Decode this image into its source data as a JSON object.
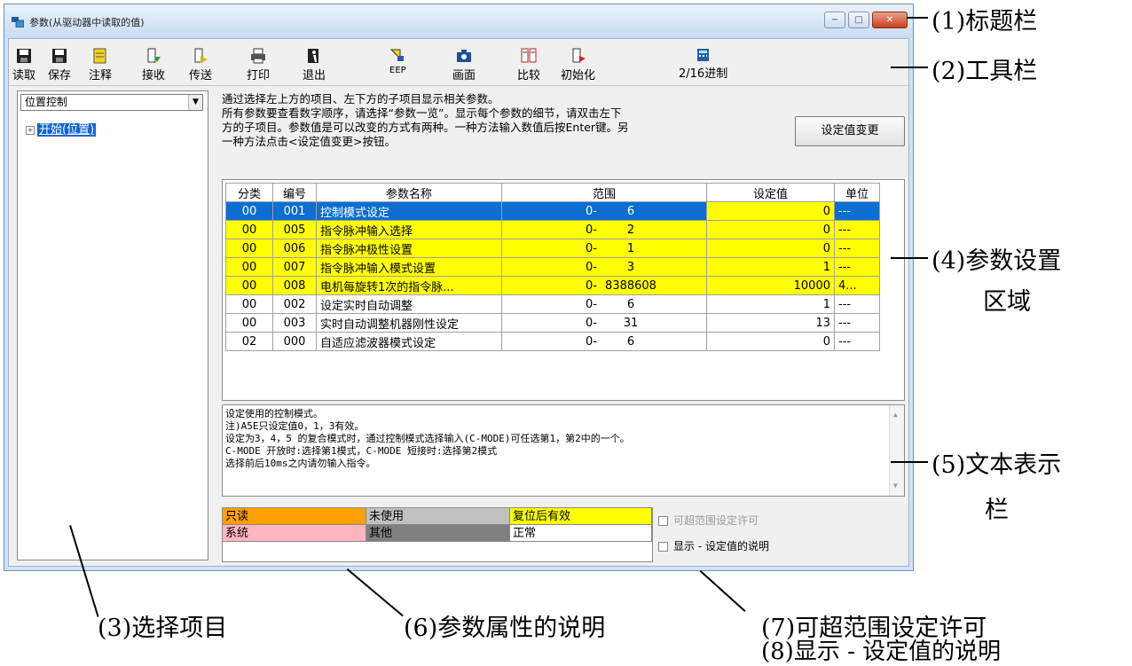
{
  "window": {
    "title": "参数(从驱动器中读取的值)",
    "controls": [
      "−",
      "□",
      "✕"
    ]
  },
  "toolbar": [
    {
      "label": "读取",
      "icon": "floppy-read-icon"
    },
    {
      "label": "保存",
      "icon": "floppy-save-icon"
    },
    {
      "label": "注释",
      "icon": "note-icon"
    },
    {
      "label": "接收",
      "icon": "receive-icon"
    },
    {
      "label": "传送",
      "icon": "send-icon"
    },
    {
      "label": "打印",
      "icon": "printer-icon"
    },
    {
      "label": "退出",
      "icon": "exit-icon"
    },
    {
      "label": "EEP",
      "icon": "eeprom-icon"
    },
    {
      "label": "画面",
      "icon": "camera-icon"
    },
    {
      "label": "比较",
      "icon": "compare-icon"
    },
    {
      "label": "初始化",
      "icon": "init-icon"
    },
    {
      "label": "2/16进制",
      "icon": "calculator-icon"
    }
  ],
  "left": {
    "select_value": "位置控制",
    "tree_item": "开始(位置)"
  },
  "description": [
    "通过选择左上方的项目、左下方的子项目显示相关参数。",
    "所有参数要查看数字顺序，请选择“参数一览”。显示每个参数的细节，请双击左下",
    "方的子项目。参数值是可以改变的方式有两种。一种方法输入数值后按Enter键。另",
    "一种方法点击<设定值变更>按钮。"
  ],
  "change_button": "设定值变更",
  "table": {
    "headers": [
      "分类",
      "编号",
      "参数名称",
      "范围",
      "设定值",
      "单位"
    ],
    "rows": [
      {
        "cat": "00",
        "no": "001",
        "name": "控制模式设定",
        "min": "0-",
        "max": "6",
        "value": "0",
        "unit": "---",
        "style": "sel"
      },
      {
        "cat": "00",
        "no": "005",
        "name": "指令脉冲输入选择",
        "min": "0-",
        "max": "2",
        "value": "0",
        "unit": "---",
        "style": "yel"
      },
      {
        "cat": "00",
        "no": "006",
        "name": "指令脉冲极性设置",
        "min": "0-",
        "max": "1",
        "value": "0",
        "unit": "---",
        "style": "yel"
      },
      {
        "cat": "00",
        "no": "007",
        "name": "指令脉冲输入模式设置",
        "min": "0-",
        "max": "3",
        "value": "1",
        "unit": "---",
        "style": "yel"
      },
      {
        "cat": "00",
        "no": "008",
        "name": "电机每旋转1次的指令脉...",
        "min": "0-",
        "max": "8388608",
        "value": "10000",
        "unit": "4...",
        "style": "yel"
      },
      {
        "cat": "00",
        "no": "002",
        "name": "设定实时自动调整",
        "min": "0-",
        "max": "6",
        "value": "1",
        "unit": "---",
        "style": "norm"
      },
      {
        "cat": "00",
        "no": "003",
        "name": "实时自动调整机器刚性设定",
        "min": "0-",
        "max": "31",
        "value": "13",
        "unit": "---",
        "style": "norm"
      },
      {
        "cat": "02",
        "no": "000",
        "name": "自适应滤波器模式设定",
        "min": "0-",
        "max": "6",
        "value": "0",
        "unit": "---",
        "style": "norm"
      }
    ]
  },
  "text_panel": [
    "设定使用的控制模式。",
    "注)A5E只设定值0，1，3有效。",
    "设定为3，4，5 的复合模式时，通过控制模式选择输入(C-MODE)可任选第1，第2中的一个。",
    "C-MODE 开放时:选择第1模式，C-MODE 短接时:选择第2模式",
    "选择前后10ms之内请勿输入指令。"
  ],
  "legend": {
    "readonly": "只读",
    "unused": "未使用",
    "reset": "复位后有效",
    "system": "系统",
    "other": "其他",
    "normal": "正常"
  },
  "options": {
    "out_of_range": "可超范围设定许可",
    "show_desc": "显示 - 设定值的说明"
  },
  "annotations": {
    "a1": "(1)标题栏",
    "a2": "(2)工具栏",
    "a4": "(4)参数设置",
    "a4b": "区域",
    "a5": "(5)文本表示",
    "a5b": "栏",
    "a3": "(3)选择项目",
    "a6": "(6)参数属性的说明",
    "a7": "(7)可超范围设定许可",
    "a8": "(8)显示 - 设定值的说明"
  },
  "colors": {
    "selected_row": "#0b6ed0",
    "yellow": "#ffff00",
    "readonly": "#ff9f00",
    "unused": "#c0c0c0",
    "system": "#ffb6c1",
    "other": "#7f7f7f"
  }
}
